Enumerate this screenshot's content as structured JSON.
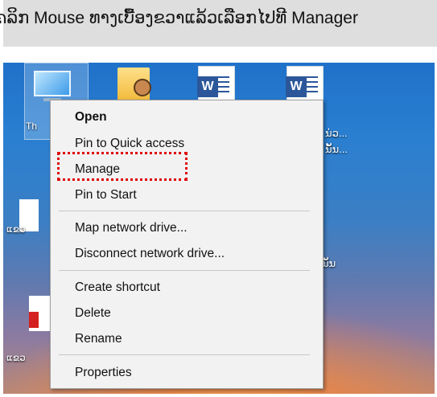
{
  "caption": "ຄລິກ Mouse ທາງເບື້ອງຂວາແລ້ວເລືອກໄປທີ Manager",
  "desktop": {
    "selected_icon_label": "Th",
    "right_label_1": "ນ່ວ...",
    "right_label_2": "ນັ້ນ...",
    "right_label_3": "ຼ",
    "right_label_4": "ນັ້ນ",
    "left_label_1": "ແຂວ",
    "left_label_2": "ແຂວ",
    "word_icon_letter": "W"
  },
  "context_menu": {
    "items": [
      {
        "label": "Open",
        "bold": true
      },
      {
        "label": "Pin to Quick access"
      },
      {
        "label": "Manage",
        "highlighted": true
      },
      {
        "label": "Pin to Start"
      },
      {
        "label": "Map network drive..."
      },
      {
        "label": "Disconnect network drive..."
      },
      {
        "label": "Create shortcut"
      },
      {
        "label": "Delete"
      },
      {
        "label": "Rename"
      },
      {
        "label": "Properties"
      }
    ],
    "highlight_color": "#e00000"
  },
  "colors": {
    "menu_bg": "#f2f2f2",
    "caption_bg": "#dedede",
    "word_blue": "#2b579a"
  }
}
